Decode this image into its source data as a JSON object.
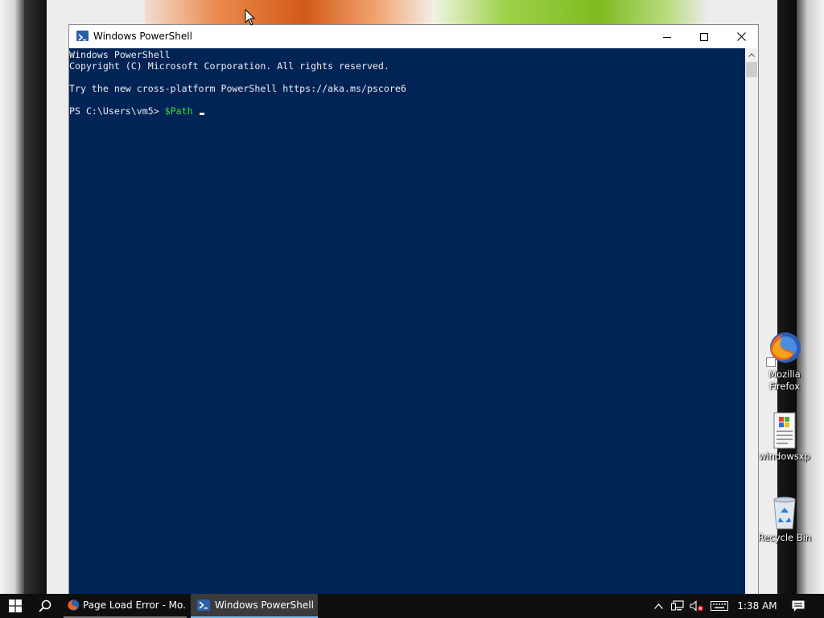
{
  "window": {
    "title": "Windows PowerShell",
    "minimize_glyph": "—",
    "console_lines": [
      "Windows PowerShell",
      "Copyright (C) Microsoft Corporation. All rights reserved.",
      "",
      "Try the new cross-platform PowerShell https://aka.ms/pscore6",
      ""
    ],
    "prompt": "PS C:\\Users\\vm5> ",
    "command": "$Path",
    "colors": {
      "console_background": "#012456",
      "console_text": "#eeedf0",
      "command_highlight": "#3fdb3f"
    }
  },
  "desktop_icons": [
    {
      "name": "Mozilla Firefox",
      "label_line1": "Mozilla",
      "label_line2": "Firefox",
      "icon": "firefox-icon"
    },
    {
      "name": "windowsxp",
      "label_line1": "windowsxp",
      "icon": "document-icon"
    },
    {
      "name": "Recycle Bin",
      "label_line1": "Recycle Bin",
      "icon": "recycle-bin-icon"
    }
  ],
  "taskbar": {
    "start_icon": "windows-logo-icon",
    "search_icon": "search-icon",
    "items": [
      {
        "label": "Page Load Error - Mo...",
        "icon": "firefox-icon",
        "active": false
      },
      {
        "label": "Windows PowerShell",
        "icon": "powershell-icon",
        "active": true
      }
    ],
    "tray_icons": [
      "chevron-up-icon",
      "network-icon",
      "volume-muted-icon",
      "keyboard-icon"
    ],
    "clock": "1:38 AM",
    "action_center_icon": "notification-icon"
  }
}
